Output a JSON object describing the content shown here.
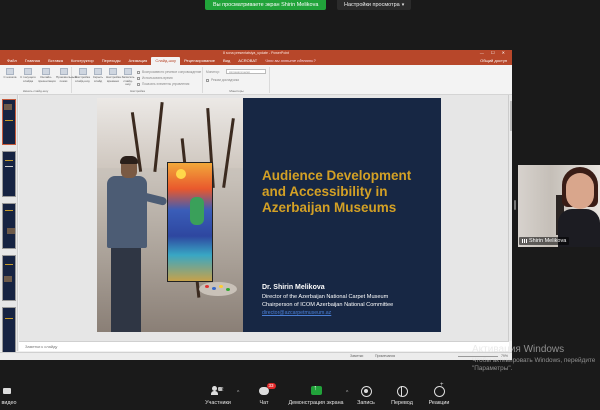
{
  "zoom": {
    "share_banner": "Вы просматриваете экран Shirin Melikova",
    "view_options": "Настройки просмотра",
    "participant_name": "Shirin Melikova",
    "toolbar": {
      "video": "видео",
      "participants": "Участники",
      "participants_count": "52",
      "chat": "Чат",
      "chat_badge": "33",
      "share": "Демонстрация экрана",
      "record": "Запись",
      "translate": "Перевод",
      "reactions": "Реакции"
    }
  },
  "powerpoint": {
    "title_bar": "8 sona presentatsiya_update - PowerPoint",
    "window_controls": "— ☐ ✕",
    "tabs": [
      "Файл",
      "Главная",
      "Вставка",
      "Конструктор",
      "Переходы",
      "Анимация",
      "Слайд-шоу",
      "Рецензирование",
      "Вид",
      "ACROBAT"
    ],
    "active_tab": "Слайд-шоу",
    "search_hint": "Что вы хотите сделать?",
    "share": "Общий доступ",
    "ribbon": {
      "from_beginning": "С начала",
      "from_current": "С текущего слайда",
      "online_presentation": "Онлайн-презентация",
      "custom_show": "Произвольный показ",
      "group_start": "Начать слайд-шоу",
      "setup": "Настройка слайд-шоу",
      "hide_slide": "Скрыть слайд",
      "rehearse": "Настройка времени",
      "record": "Записать слайд-шоу",
      "play_narrations": "Воспроизвести речевое сопровождение",
      "use_timings": "Использовать время",
      "show_media_controls": "Показать элементы управления",
      "group_setup": "Настройка",
      "monitor_label": "Монитор:",
      "monitor_value": "Автоматически",
      "presenter_view": "Режим докладчика",
      "group_monitors": "Мониторы"
    },
    "notes_placeholder": "Заметки к слайду",
    "status": {
      "notes": "Заметки",
      "comments": "Примечания",
      "zoom": "79%"
    }
  },
  "slide": {
    "title": "Audience Development and Accessibility in Azerbaijan Museums",
    "author": "Dr. Shirin Melikova",
    "role1": "Director of the Azerbaijan National Carpet Museum",
    "role2": "Chairperson of ICOM Azerbaijan National Committee",
    "email": "director@azcarpetmuseum.az"
  },
  "windows": {
    "activation_title": "Активация Windows",
    "activation_line1": "Чтобы активировать Windows, перейдите",
    "activation_line2": "\"Параметры\"."
  },
  "colors": {
    "slide_bg": "#172744",
    "slide_title": "#d3a025",
    "ppt_accent": "#b7472a",
    "zoom_green": "#21a33a"
  }
}
